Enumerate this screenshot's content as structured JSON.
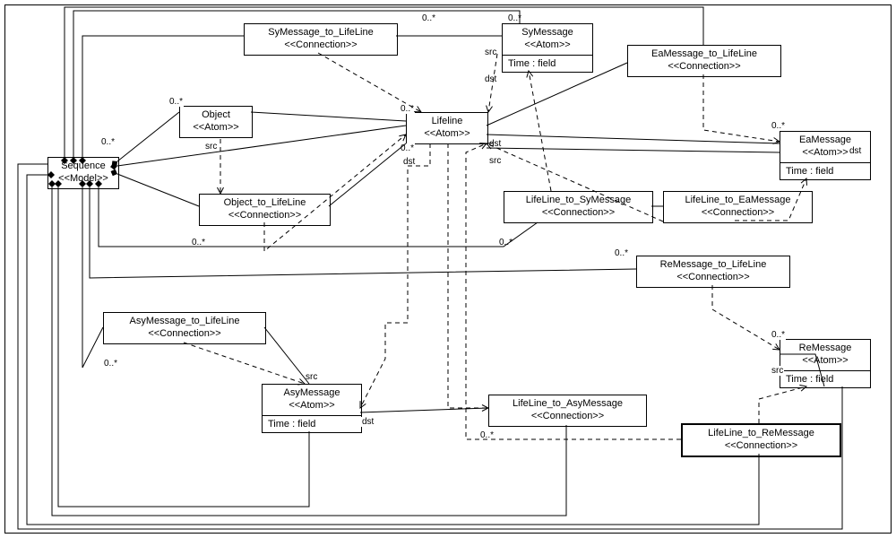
{
  "stereotypes": {
    "model": "<<Model>>",
    "atom": "<<Atom>>",
    "conn": "<<Connection>>"
  },
  "attr_time": "Time : field",
  "mult": "0..*",
  "role": {
    "src": "src",
    "dst": "dst"
  },
  "boxes": {
    "sequence": {
      "title": "Sequence"
    },
    "object": {
      "title": "Object"
    },
    "symsg_ll": {
      "title": "SyMessage_to_LifeLine"
    },
    "symsg": {
      "title": "SyMessage"
    },
    "eamsg_ll": {
      "title": "EaMessage_to_LifeLine"
    },
    "lifeline": {
      "title": "Lifeline"
    },
    "eamsg": {
      "title": "EaMessage"
    },
    "obj_ll": {
      "title": "Object_to_LifeLine"
    },
    "ll_sy": {
      "title": "LifeLine_to_SyMessage"
    },
    "ll_ea": {
      "title": "LifeLine_to_EaMessage"
    },
    "remsg_ll": {
      "title": "ReMessage_to_LifeLine"
    },
    "asymsg_ll": {
      "title": "AsyMessage_to_LifeLine"
    },
    "remsg": {
      "title": "ReMessage"
    },
    "asymsg": {
      "title": "AsyMessage"
    },
    "ll_asy": {
      "title": "LifeLine_to_AsyMessage"
    },
    "ll_re": {
      "title": "LifeLine_to_ReMessage"
    }
  }
}
